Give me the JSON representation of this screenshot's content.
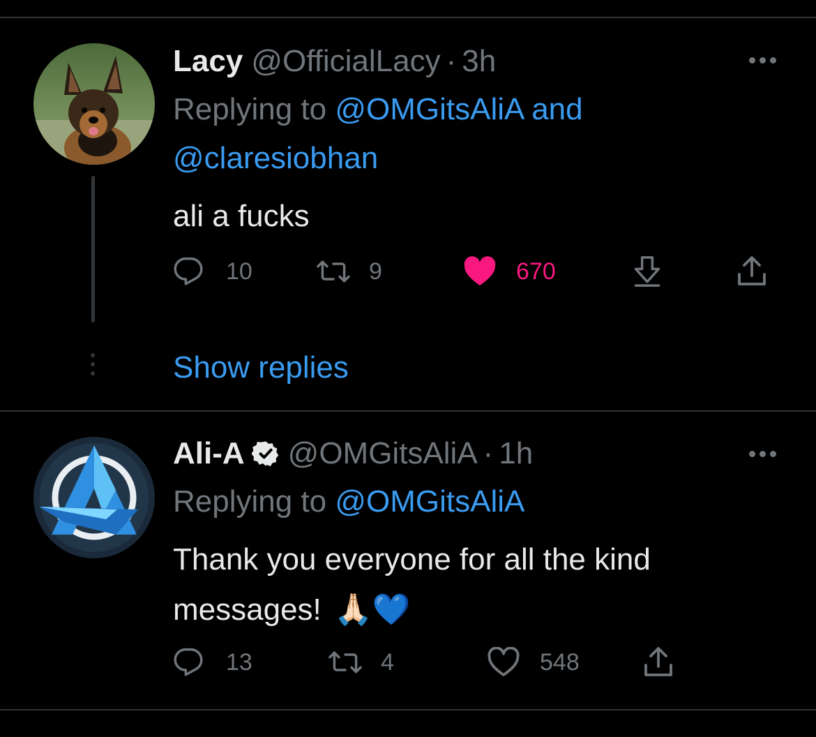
{
  "tweets": [
    {
      "display_name": "Lacy",
      "handle": "@OfficialLacy",
      "separator": "·",
      "time": "3h",
      "replying_prefix": "Replying to",
      "replying_mention_1": "@OMGitsAliA",
      "replying_conj": "and",
      "replying_mention_2": "@claresiobhan",
      "text": "ali a fucks",
      "reply_count": "10",
      "retweet_count": "9",
      "like_count": "670",
      "liked": true,
      "avatar_icon": "german-shepherd-puppy-avatar",
      "more_icon": "more-dots-icon"
    },
    {
      "display_name": "Ali-A",
      "handle": "@OMGitsAliA",
      "separator": "·",
      "time": "1h",
      "verified": true,
      "replying_prefix": "Replying to",
      "replying_mention_1": "@OMGitsAliA",
      "text_line1": "Thank you everyone for all the kind",
      "text_line2": "messages!",
      "emoji": "🙏🏻💙",
      "reply_count": "13",
      "retweet_count": "4",
      "like_count": "548",
      "liked": false,
      "avatar_icon": "ali-a-logo-avatar",
      "more_icon": "more-dots-icon"
    }
  ],
  "show_replies_label": "Show replies",
  "colors": {
    "background": "#000000",
    "primary_text": "#e7e9ea",
    "secondary_text": "#71767b",
    "link": "#3a9bf0",
    "like": "#f91880",
    "divider": "#2f3336"
  }
}
